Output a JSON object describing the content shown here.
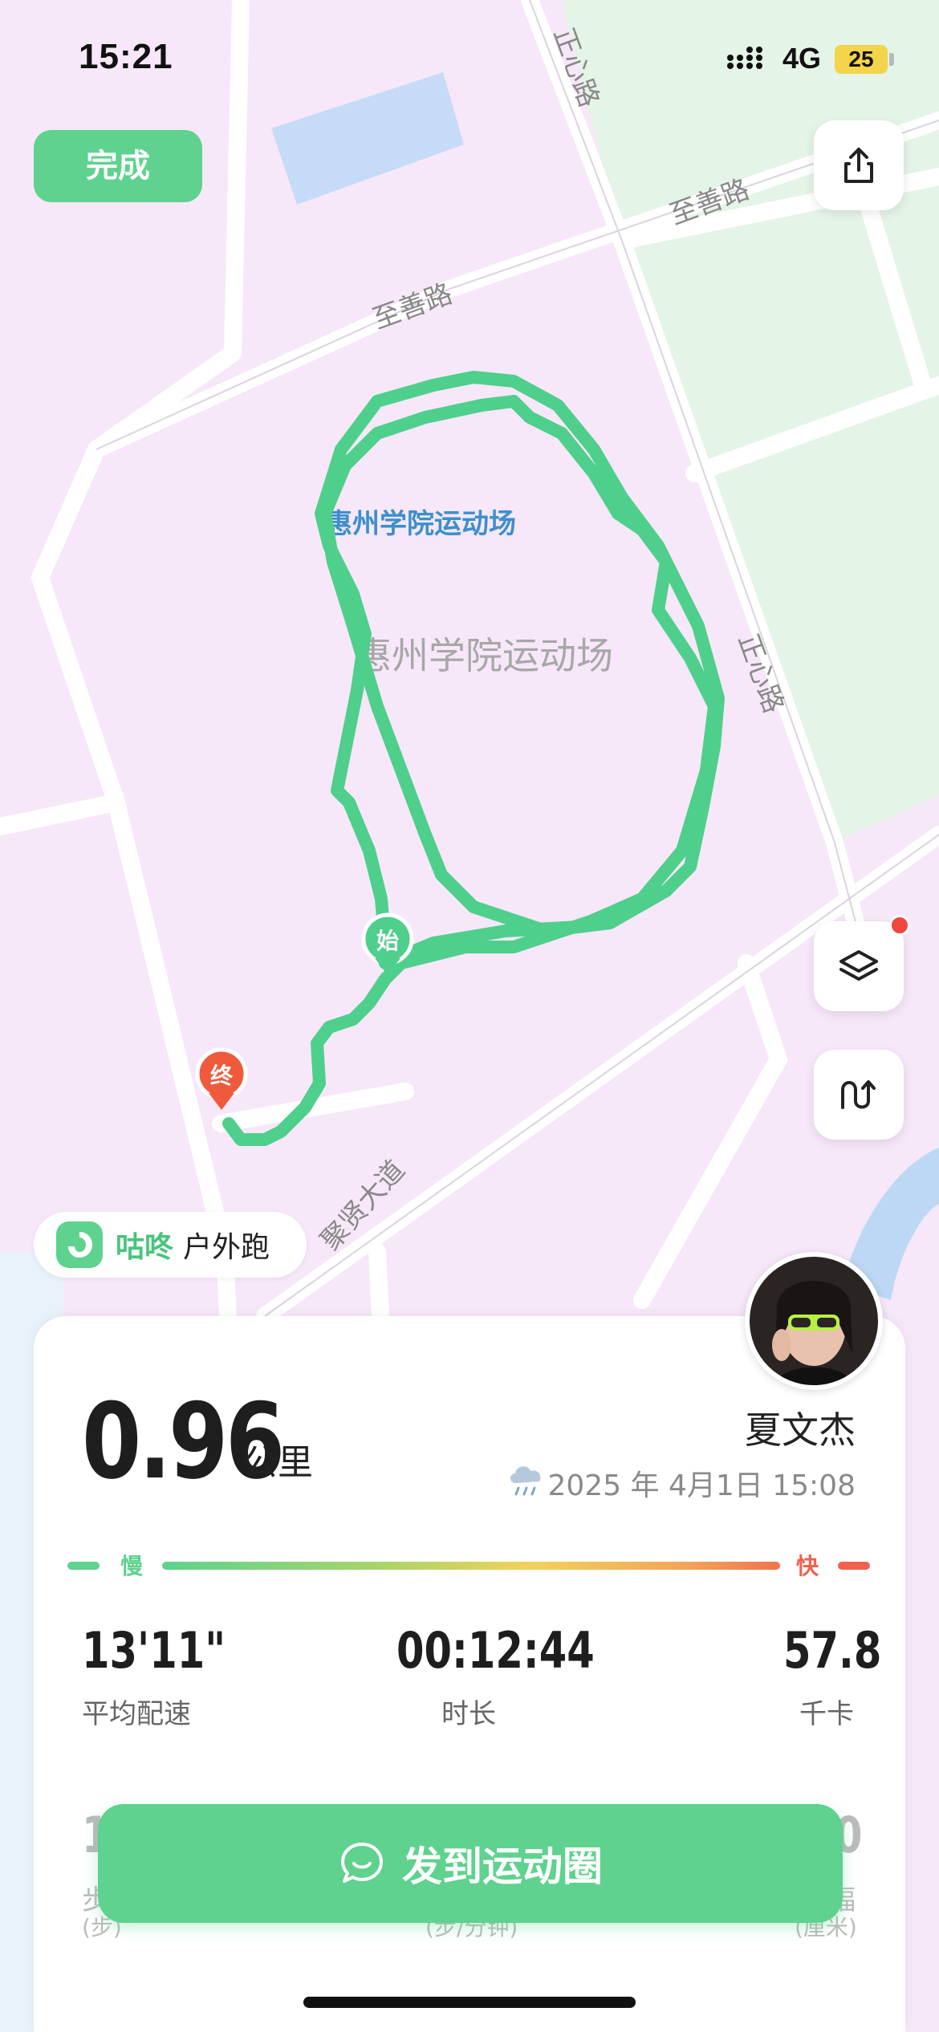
{
  "status_bar": {
    "time": "15:21",
    "network": "4G",
    "battery": "25"
  },
  "top": {
    "done_label": "完成"
  },
  "map": {
    "roads": [
      "正心路",
      "至善路",
      "至善路",
      "正心路",
      "聚贤大道"
    ],
    "venue_label": "惠州学院运动场",
    "venue_label_gray": "惠州学院运动场",
    "start_marker": "始",
    "end_marker": "终"
  },
  "app_chip": {
    "name": "咕咚",
    "mode": "户外跑"
  },
  "summary": {
    "distance": "0.96",
    "distance_unit": "公里",
    "user_name": "夏文杰",
    "datetime": "2025 年 4月1日 15:08",
    "pace_slow": "慢",
    "pace_fast": "快"
  },
  "stats": [
    {
      "value": "13'11\"",
      "label": "平均配速"
    },
    {
      "value": "00:12:44",
      "label": "时长"
    },
    {
      "value": "57.8",
      "label": "千卡"
    }
  ],
  "stats_partial": {
    "left_value": "1",
    "left_label": "步",
    "left_sub": "(步)",
    "mid_sub": "(步/分钟)",
    "right_value": "0",
    "right_label": "幅",
    "right_sub": "(厘米)"
  },
  "share_button": {
    "label": "发到运动圈"
  },
  "colors": {
    "accent": "#5ed28e",
    "track": "#4fcf8c",
    "end_marker": "#ef5a3c"
  },
  "icons": [
    "share-icon",
    "layers-icon",
    "route-replay-icon",
    "chat-bubble-icon",
    "weather-icon"
  ]
}
